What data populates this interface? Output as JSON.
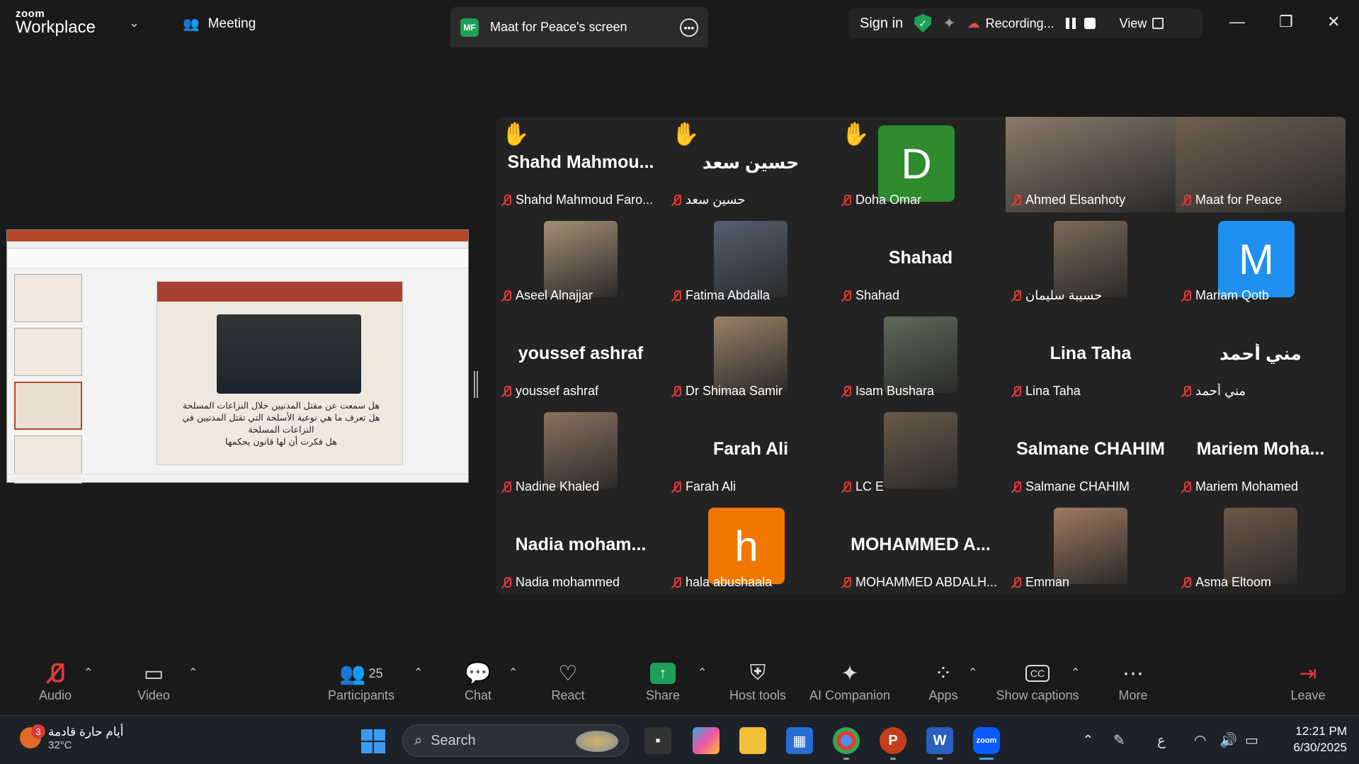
{
  "titlebar": {
    "logo_small": "zoom",
    "logo_big": "Workplace",
    "meeting_label": "Meeting",
    "tab_initials": "MF",
    "tab_label": "Maat for Peace's screen",
    "sign_in": "Sign in",
    "recording_label": "Recording...",
    "view_label": "View"
  },
  "slide": {
    "lines": [
      "هل سمعت عن مقتل المدنيين خلال النزاعات المسلحة",
      "هل تعرف ما هي نوعية الأسلحة التي تقتل المدنيين في النزاعات المسلحة",
      "هل فكرت أن لها قانون يحكمها"
    ]
  },
  "gallery": {
    "tiles": [
      {
        "big": "Shahd  Mahmou...",
        "label": "Shahd Mahmoud Faro...",
        "hand": true
      },
      {
        "big": "حسين سعد",
        "label": "حسين سعد",
        "hand": true,
        "rtl": true
      },
      {
        "avatar": "D",
        "label": "Doha Omar",
        "hand": true
      },
      {
        "photo": true,
        "label": "Ahmed Elsanhoty"
      },
      {
        "photo": true,
        "label": "Maat for Peace",
        "active": true
      },
      {
        "photo": true,
        "label": "Aseel Alnajjar"
      },
      {
        "photo": true,
        "label": "Fatima Abdalla"
      },
      {
        "big": "Shahad",
        "label": "Shahad"
      },
      {
        "photo": true,
        "label": "حسيبة سليمان",
        "rtl": true
      },
      {
        "avatar": "M",
        "label": "Mariam Qotb"
      },
      {
        "big": "youssef ashraf",
        "label": "youssef ashraf"
      },
      {
        "photo": true,
        "label": "Dr Shimaa Samir"
      },
      {
        "photo": true,
        "label": "Isam Bushara"
      },
      {
        "big": "Lina Taha",
        "label": "Lina Taha"
      },
      {
        "big": "مني أحمد",
        "label": "مني أحمد",
        "rtl": true
      },
      {
        "photo": true,
        "label": "Nadine Khaled"
      },
      {
        "big": "Farah Ali",
        "label": "Farah Ali"
      },
      {
        "photo": true,
        "label": "LC E"
      },
      {
        "big": "Salmane CHAHIM",
        "label": "Salmane CHAHIM"
      },
      {
        "big": "Mariem  Moha...",
        "label": "Mariem Mohamed"
      },
      {
        "big": "Nadia  moham...",
        "label": "Nadia mohammed"
      },
      {
        "avatar": "h",
        "label": "hala abushaala"
      },
      {
        "big": "MOHAMMED  A...",
        "label": "MOHAMMED ABDALH..."
      },
      {
        "photo": true,
        "label": "Emman"
      },
      {
        "photo": true,
        "label": "Asma Eltoom"
      }
    ]
  },
  "toolbar": {
    "audio": "Audio",
    "video": "Video",
    "participants": "Participants",
    "participants_count": "25",
    "chat": "Chat",
    "react": "React",
    "share": "Share",
    "host_tools": "Host tools",
    "ai_companion": "AI Companion",
    "apps": "Apps",
    "show_captions": "Show captions",
    "more": "More",
    "leave": "Leave"
  },
  "taskbar": {
    "weather_text": "أيام حارة قادمة",
    "weather_temp": "32°C",
    "weather_badge": "3",
    "search_label": "Search",
    "lang": "ع",
    "time": "12:21 PM",
    "date": "6/30/2025"
  },
  "colors": {
    "accent_green": "#1ea05a",
    "active_outline": "#2ed27a",
    "muted_red": "#e03a3a",
    "hand_yellow": "#f5b400",
    "avatar_d": "#2e8b2e",
    "avatar_m": "#1f8ff0",
    "avatar_h": "#f07800"
  }
}
